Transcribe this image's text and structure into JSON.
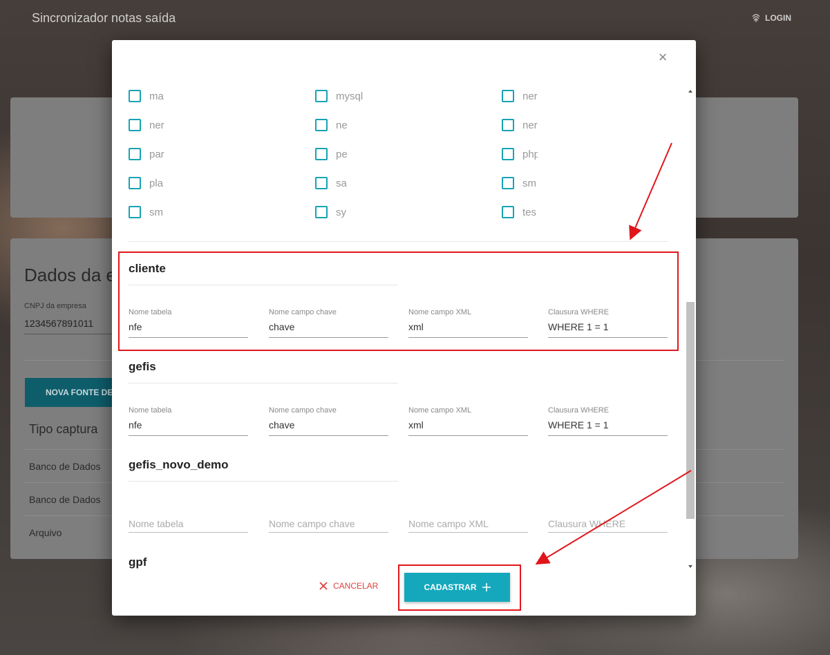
{
  "app": {
    "title": "Sincronizador notas saída",
    "login_label": "LOGIN"
  },
  "background_card": {
    "title": "Dados da e",
    "cnpj_label": "CNPJ da empresa",
    "cnpj_value": "1234567891011",
    "nova_fonte_label": "NOVA FONTE DE D",
    "tipo_header": "Tipo captura",
    "rows": [
      "Banco de Dados",
      "Banco de Dados",
      "Arquivo"
    ]
  },
  "modal": {
    "checkbox_rows": [
      [
        "ma",
        "mysql",
        "ner"
      ],
      [
        "ner",
        "ne",
        "ner"
      ],
      [
        "par",
        "pe",
        "php"
      ],
      [
        "pla",
        "sa",
        "sm"
      ],
      [
        "sm",
        "sy",
        "tes"
      ]
    ],
    "sections": [
      {
        "title": "cliente",
        "fields": [
          {
            "label": "Nome tabela",
            "value": "nfe"
          },
          {
            "label": "Nome campo chave",
            "value": "chave"
          },
          {
            "label": "Nome campo XML",
            "value": "xml"
          },
          {
            "label": "Clausura WHERE",
            "value": "WHERE 1 = 1"
          }
        ]
      },
      {
        "title": "gefis",
        "fields": [
          {
            "label": "Nome tabela",
            "value": "nfe"
          },
          {
            "label": "Nome campo chave",
            "value": "chave"
          },
          {
            "label": "Nome campo XML",
            "value": "xml"
          },
          {
            "label": "Clausura WHERE",
            "value": "WHERE 1 = 1"
          }
        ]
      },
      {
        "title": "gefis_novo_demo",
        "placeholders": [
          "Nome tabela",
          "Nome campo chave",
          "Nome campo XML",
          "Clausura WHERE"
        ]
      },
      {
        "title": "gpf"
      }
    ],
    "cancel_label": "CANCELAR",
    "submit_label": "CADASTRAR",
    "close_glyph": "×"
  },
  "colors": {
    "accent": "#15a8bd",
    "cancel": "#e0403a",
    "annotation": "#e0161b"
  }
}
